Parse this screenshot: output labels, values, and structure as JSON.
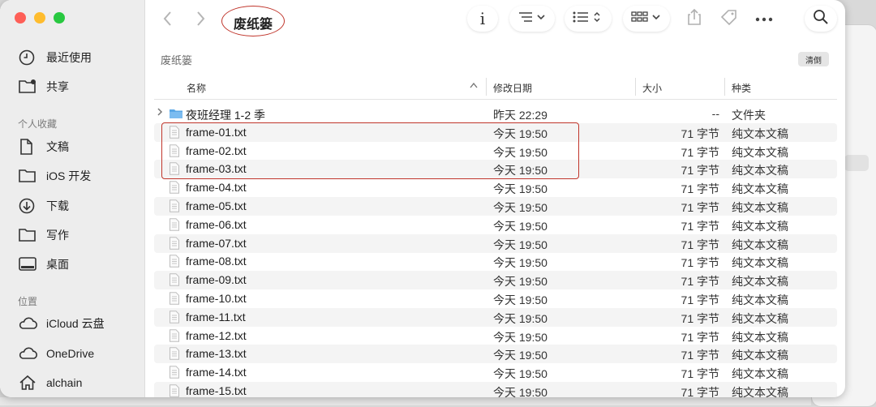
{
  "window": {
    "title": "废纸篓",
    "location_label": "废纸篓",
    "clear_label": "清倒"
  },
  "sidebar": {
    "items_top": [
      {
        "label": "最近使用",
        "icon": "clock-icon"
      },
      {
        "label": "共享",
        "icon": "shared-folder-icon"
      }
    ],
    "favorites_title": "个人收藏",
    "favorites": [
      {
        "label": "文稿",
        "icon": "document-icon"
      },
      {
        "label": "iOS 开发",
        "icon": "folder-icon"
      },
      {
        "label": "下载",
        "icon": "download-icon"
      },
      {
        "label": "写作",
        "icon": "folder-icon"
      },
      {
        "label": "桌面",
        "icon": "desktop-icon"
      }
    ],
    "locations_title": "位置",
    "locations": [
      {
        "label": "iCloud 云盘",
        "icon": "cloud-icon"
      },
      {
        "label": "OneDrive",
        "icon": "cloud-icon"
      },
      {
        "label": "alchain",
        "icon": "home-icon"
      }
    ]
  },
  "toolbar": {
    "back_icon": "chevron-left-icon",
    "forward_icon": "chevron-right-icon",
    "info_icon": "info-icon",
    "sort_icon": "sort-list-icon",
    "view_icon": "list-view-icon",
    "group_icon": "grid-view-icon",
    "share_icon": "share-icon",
    "tag_icon": "tag-icon",
    "more_icon": "more-icon",
    "search_icon": "search-icon"
  },
  "columns": {
    "name": "名称",
    "modified": "修改日期",
    "size": "大小",
    "kind": "种类"
  },
  "files": [
    {
      "name": "夜班经理 1-2 季",
      "modified": "昨天 22:29",
      "size": "--",
      "kind": "文件夹",
      "type": "folder"
    },
    {
      "name": "frame-01.txt",
      "modified": "今天 19:50",
      "size": "71 字节",
      "kind": "纯文本文稿",
      "type": "text"
    },
    {
      "name": "frame-02.txt",
      "modified": "今天 19:50",
      "size": "71 字节",
      "kind": "纯文本文稿",
      "type": "text"
    },
    {
      "name": "frame-03.txt",
      "modified": "今天 19:50",
      "size": "71 字节",
      "kind": "纯文本文稿",
      "type": "text"
    },
    {
      "name": "frame-04.txt",
      "modified": "今天 19:50",
      "size": "71 字节",
      "kind": "纯文本文稿",
      "type": "text"
    },
    {
      "name": "frame-05.txt",
      "modified": "今天 19:50",
      "size": "71 字节",
      "kind": "纯文本文稿",
      "type": "text"
    },
    {
      "name": "frame-06.txt",
      "modified": "今天 19:50",
      "size": "71 字节",
      "kind": "纯文本文稿",
      "type": "text"
    },
    {
      "name": "frame-07.txt",
      "modified": "今天 19:50",
      "size": "71 字节",
      "kind": "纯文本文稿",
      "type": "text"
    },
    {
      "name": "frame-08.txt",
      "modified": "今天 19:50",
      "size": "71 字节",
      "kind": "纯文本文稿",
      "type": "text"
    },
    {
      "name": "frame-09.txt",
      "modified": "今天 19:50",
      "size": "71 字节",
      "kind": "纯文本文稿",
      "type": "text"
    },
    {
      "name": "frame-10.txt",
      "modified": "今天 19:50",
      "size": "71 字节",
      "kind": "纯文本文稿",
      "type": "text"
    },
    {
      "name": "frame-11.txt",
      "modified": "今天 19:50",
      "size": "71 字节",
      "kind": "纯文本文稿",
      "type": "text"
    },
    {
      "name": "frame-12.txt",
      "modified": "今天 19:50",
      "size": "71 字节",
      "kind": "纯文本文稿",
      "type": "text"
    },
    {
      "name": "frame-13.txt",
      "modified": "今天 19:50",
      "size": "71 字节",
      "kind": "纯文本文稿",
      "type": "text"
    },
    {
      "name": "frame-14.txt",
      "modified": "今天 19:50",
      "size": "71 字节",
      "kind": "纯文本文稿",
      "type": "text"
    },
    {
      "name": "frame-15.txt",
      "modified": "今天 19:50",
      "size": "71 字节",
      "kind": "纯文本文稿",
      "type": "text"
    }
  ],
  "colors": {
    "annotation": "#c0352b",
    "folder_blue": "#5aa7e6"
  }
}
